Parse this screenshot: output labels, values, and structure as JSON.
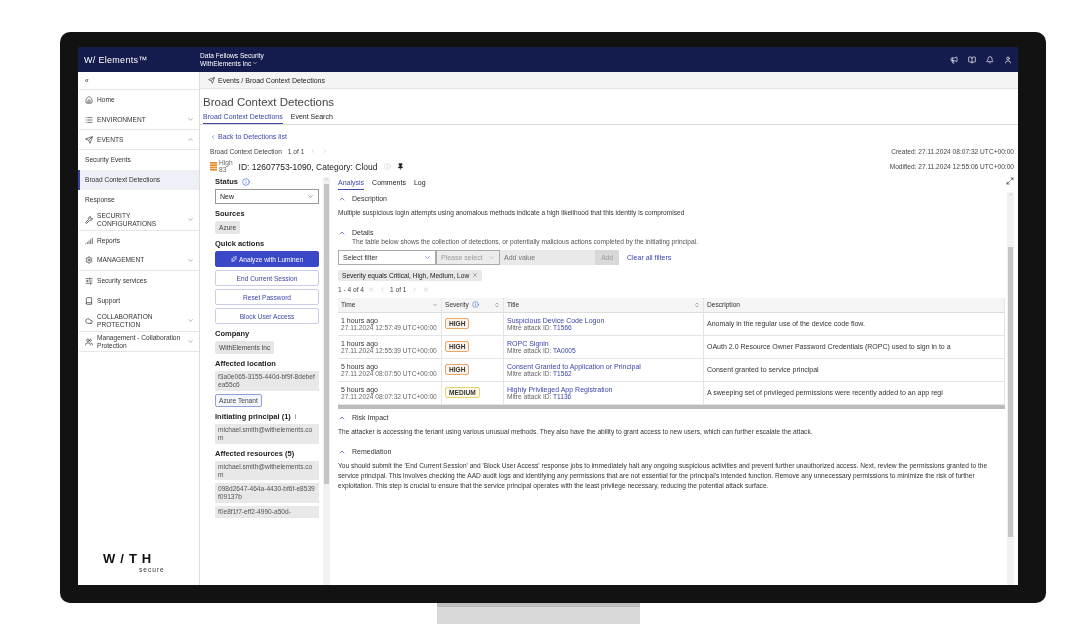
{
  "topbar": {
    "logo": "W/ Elements™",
    "org": "Data Fellows Security",
    "account": "WithElements Inc"
  },
  "sidebar": {
    "collapse": "«",
    "items": [
      {
        "kind": "link",
        "label": "Home",
        "selected": false
      },
      {
        "kind": "category",
        "label": "ENVIRONMENT",
        "expanded": false
      },
      {
        "kind": "category",
        "label": "EVENTS",
        "expanded": true,
        "children": [
          {
            "label": "Security Events",
            "selected": false
          },
          {
            "label": "Broad Context Detections",
            "selected": true
          },
          {
            "label": "Response",
            "selected": false
          }
        ]
      },
      {
        "kind": "category",
        "label": "SECURITY CONFIGURATIONS",
        "expanded": false
      },
      {
        "kind": "link",
        "label": "Reports",
        "selected": false
      },
      {
        "kind": "category",
        "label": "MANAGEMENT",
        "expanded": false
      },
      {
        "kind": "link",
        "label": "Security services",
        "selected": false
      },
      {
        "kind": "link",
        "label": "Support",
        "selected": false
      },
      {
        "kind": "category",
        "label": "COLLABORATION PROTECTION",
        "expanded": false
      },
      {
        "kind": "group",
        "label": "Management - Collaboration Protection",
        "expanded": false
      }
    ],
    "brand": {
      "mark": "W/TH",
      "sub": "secure"
    }
  },
  "breadcrumb": "Events / Broad Context Detections",
  "title": "Broad Context Detections",
  "tabs": [
    {
      "label": "Broad Context Detections",
      "selected": true
    },
    {
      "label": "Event Search",
      "selected": false
    }
  ],
  "detection": {
    "back": "Back to Detections list",
    "label": "Broad Context Detection",
    "counter": "1 of 1",
    "severity": {
      "label": "High",
      "score": "83"
    },
    "heading": "ID: 12607753-1090, Category: Cloud",
    "pinned": true,
    "created": "Created: 27.11.2024 08:07:32 UTC+00:00",
    "modified": "Modified: 27.11.2024 12:55:06 UTC+00:00"
  },
  "side_panel": [
    {
      "title": "Status",
      "info": true,
      "select": "New"
    },
    {
      "title": "Sources",
      "tags": [
        {
          "label": "Azure",
          "kind": "plain"
        }
      ]
    },
    {
      "title": "Quick actions",
      "buttons": [
        {
          "label": "Analyze with Luminen",
          "kind": "primary"
        },
        {
          "label": "End Current Session",
          "kind": "secondary"
        },
        {
          "label": "Reset Password",
          "kind": "secondary"
        },
        {
          "label": "Block User Access",
          "kind": "secondary"
        }
      ]
    },
    {
      "title": "Company",
      "tags": [
        {
          "label": "WithElements Inc",
          "kind": "plain"
        }
      ]
    },
    {
      "title": "Affected location",
      "values": [
        "f3a0e065-3155-440d-bf9f-8debefea55c6"
      ],
      "tags": [
        {
          "label": "Azure Tenant",
          "kind": "outlined"
        }
      ]
    },
    {
      "title": "Initiating principal (1)",
      "hint": "i",
      "values": [
        "michael.smith@withelements.com"
      ]
    },
    {
      "title": "Affected resources (5)",
      "values": [
        "michael.smith@withelements.com",
        "098d2647-464a-4430-bf6f-e8539f09137b",
        "f0e8f1f7-eff2-4990-a50d-"
      ]
    }
  ],
  "analysis": {
    "tabs": [
      {
        "label": "Analysis",
        "selected": true
      },
      {
        "label": "Comments",
        "selected": false
      },
      {
        "label": "Log",
        "selected": false
      }
    ],
    "sections": [
      {
        "kind": "text",
        "title": "Description",
        "expanded": true,
        "text": "Multiple suspicious login attempts using anomalous methods indicate a high likelihood that this identity is compromised"
      },
      {
        "kind": "table",
        "title": "Details",
        "expanded": true,
        "subtitle": "The table below shows the collection of detections, or potentially malicious actions completed by the initiating principal.",
        "filter": {
          "select": "Select filter",
          "operator": "Please select",
          "value_placeholder": "Add value",
          "add": "Add",
          "clear": "Clear all filters",
          "chips": [
            "Severity equals Critical, High, Medium, Low"
          ]
        },
        "pagination": {
          "range": "1 - 4 of 4",
          "page": "1 of 1"
        },
        "columns": [
          {
            "label": "Time",
            "kind": "dropdown",
            "info": false
          },
          {
            "label": "Severity",
            "kind": "sort",
            "info": true
          },
          {
            "label": "Title",
            "kind": "sort",
            "info": false
          },
          {
            "label": "Description",
            "kind": "plain",
            "info": false
          }
        ],
        "rows": [
          {
            "ago": "1 hours ago",
            "time": "27.11.2024 12:57:49 UTC+00:00",
            "severity": {
              "label": "HIGH",
              "color": "#e8a66c"
            },
            "title": "Suspicious Device Code Logon",
            "mitre": "Mitre attack ID:",
            "mitre_id": "T1566",
            "description": "Anomaly in the regular use of the device code flow."
          },
          {
            "ago": "1 hours ago",
            "time": "27.11.2024 12:55:39 UTC+00:00",
            "severity": {
              "label": "HIGH",
              "color": "#e8a66c"
            },
            "title": "ROPC Signin",
            "mitre": "Mitre attack ID:",
            "mitre_id": "TA0005",
            "description": "OAuth 2.0 Resource Owner Password Credentials (ROPC) used to sign in to a"
          },
          {
            "ago": "5 hours ago",
            "time": "27.11.2024 08:07:50 UTC+00:00",
            "severity": {
              "label": "HIGH",
              "color": "#e8a66c"
            },
            "title": "Consent Granted to Application or Principal",
            "mitre": "Mitre attack ID:",
            "mitre_id": "T1562",
            "description": "Consent granted to service principal"
          },
          {
            "ago": "5 hours ago",
            "time": "27.11.2024 08:07:32 UTC+00:00",
            "severity": {
              "label": "MEDIUM",
              "color": "#e6d46a"
            },
            "title": "Highly Privileged App Registration",
            "mitre": "Mitre attack ID:",
            "mitre_id": "T1136",
            "description": "A sweeping set of privileged permissions were recently added to an app regi"
          }
        ]
      },
      {
        "kind": "text",
        "title": "Risk Impact",
        "expanded": true,
        "text": "The attacker is accessing the tenant using various unusual methods. They also have the ability to grant access to new users, which can further escalate the attack."
      },
      {
        "kind": "text",
        "title": "Remediation",
        "expanded": true,
        "text": "You should submit the 'End Current Session' and 'Block User Access' response jobs to immediately halt any ongoing suspicious activities and prevent further unauthorized access. Next, review the permissions granted to the service principal. This involves checking the AAD audit logs and identifying any permissions that are not essential for the principal's intended function. Remove any unnecessary permissions to minimize the risk of further exploitation. This step is crucial to ensure that the service principal operates with the least privilege necessary, reducing the potential attack surface."
      }
    ]
  }
}
